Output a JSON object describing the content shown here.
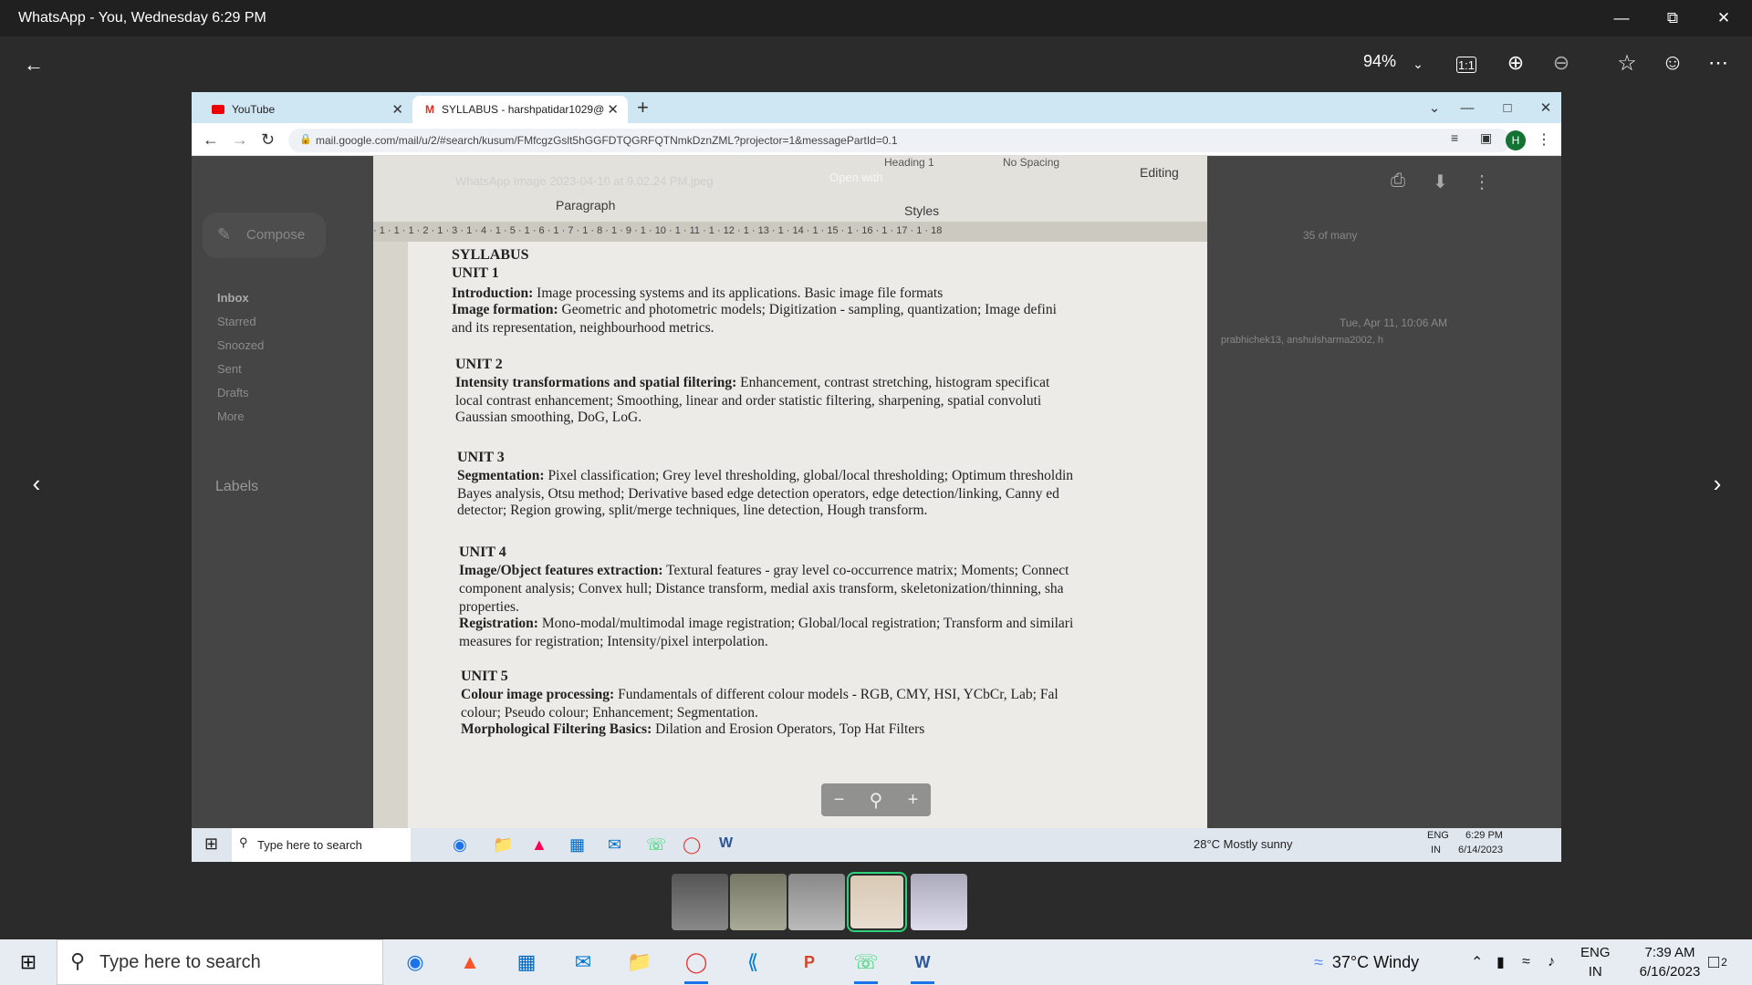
{
  "window": {
    "title": "WhatsApp - You, Wednesday 6:29 PM"
  },
  "viewer": {
    "zoom": "94%"
  },
  "inner": {
    "tabs": [
      {
        "label": "YouTube"
      },
      {
        "label": "SYLLABUS - harshpatidar1029@"
      }
    ],
    "url": "mail.google.com/mail/u/2/#search/kusum/FMfcgzGslt5hGGFDTQGRFQTNmkDznZML?projector=1&messagePartId=0.1",
    "avatar": "H",
    "gmail": {
      "compose": "Compose",
      "items": [
        "Inbox",
        "Starred",
        "Snoozed",
        "Sent",
        "Drafts",
        "More"
      ],
      "labels": "Labels",
      "image_name": "WhatsApp Image 2023-04-10 at 9.02.24 PM.jpeg",
      "open_with": "Open with",
      "count": "35 of many",
      "date": "Tue, Apr 11, 10:06 AM",
      "recipients": "prabhichek13, anshulsharma2002, h"
    },
    "ribbon": {
      "paragraph": "Paragraph",
      "styles": "Styles",
      "editing": "Editing",
      "heading": "Heading 1",
      "nospacing": "No Spacing"
    },
    "ruler": "· 1 · 1 · 1 · 2 · 1 · 3 · 1 · 4 · 1 · 5 · 1 · 6 · 1 · 7 · 1 · 8 · 1 · 9 · 1 · 10 · 1 · 11 · 1 · 12 · 1 · 13 · 1 · 14 · 1 · 15 · 1 · 16 · 1 · 17 · 1 · 18",
    "doc": {
      "title": "SYLLABUS",
      "u1": "UNIT 1",
      "u1_l1_b": "Introduction:",
      "u1_l1": " Image processing systems and its applications. Basic image file formats",
      "u1_l2_b": "Image formation:",
      "u1_l2": " Geometric and photometric models; Digitization - sampling, quantization; Image defini",
      "u1_l3": "and its representation, neighbourhood metrics.",
      "u2": "UNIT 2",
      "u2_l1_b": "Intensity transformations and spatial filtering:",
      "u2_l1": " Enhancement, contrast stretching, histogram specificat",
      "u2_l2": "local contrast enhancement; Smoothing, linear and order statistic filtering, sharpening, spatial convoluti",
      "u2_l3": "Gaussian smoothing, DoG, LoG.",
      "u3": "UNIT 3",
      "u3_l1_b": "Segmentation:",
      "u3_l1": " Pixel classification; Grey level thresholding, global/local thresholding; Optimum thresholdin",
      "u3_l2": "Bayes analysis, Otsu method; Derivative based edge detection operators, edge detection/linking, Canny ed",
      "u3_l3": "detector; Region growing, split/merge techniques, line detection, Hough transform.",
      "u4": "UNIT 4",
      "u4_l1_b": "Image/Object features extraction:",
      "u4_l1": " Textural features - gray level co-occurrence matrix; Moments; Connect",
      "u4_l2": "component analysis; Convex hull; Distance transform, medial axis transform, skeletonization/thinning, sha",
      "u4_l3": "properties.",
      "u4_l4_b": "Registration:",
      "u4_l4": " Mono-modal/multimodal image registration; Global/local registration; Transform and similari",
      "u4_l5": "measures for registration; Intensity/pixel interpolation.",
      "u5": "UNIT 5",
      "u5_l1_b": "Colour image processing:",
      "u5_l1": " Fundamentals of different colour models - RGB, CMY, HSI, YCbCr, Lab; Fal",
      "u5_l2": "colour; Pseudo colour; Enhancement; Segmentation.",
      "u5_l3_b": "Morphological Filtering Basics:",
      "u5_l3": " Dilation and Erosion Operators, Top Hat Filters"
    },
    "taskbar": {
      "search": "Type here to search",
      "weather": "28°C  Mostly sunny",
      "lang": "ENG",
      "region": "IN",
      "time": "6:29 PM",
      "date": "6/14/2023"
    }
  },
  "taskbar": {
    "search": "Type here to search",
    "weather": "37°C  Windy",
    "lang": "ENG",
    "region": "IN",
    "time": "7:39 AM",
    "date": "6/16/2023",
    "notif": "2"
  }
}
